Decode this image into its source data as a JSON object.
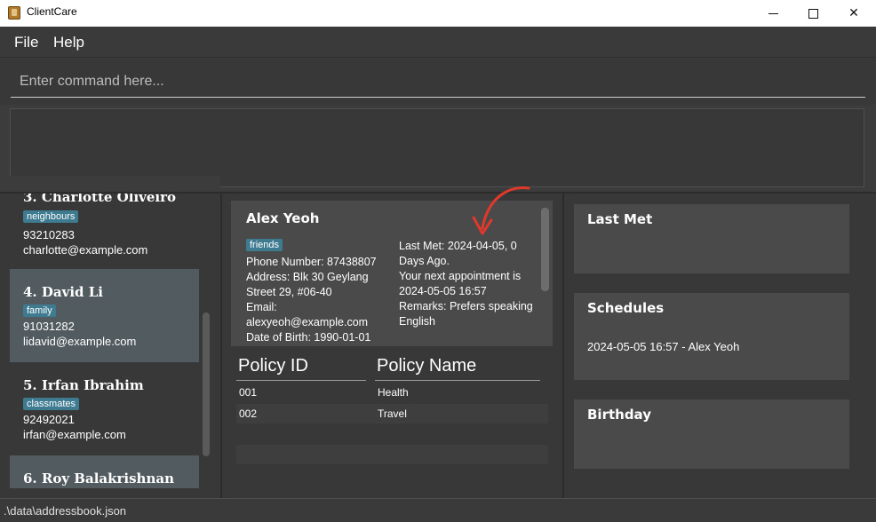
{
  "window": {
    "title": "ClientCare",
    "min_icon": "minimize-icon",
    "max_icon": "maximize-icon",
    "close_symbol": "✕"
  },
  "menu": {
    "items": [
      {
        "label": "File"
      },
      {
        "label": "Help"
      }
    ]
  },
  "command": {
    "placeholder": "Enter command here...",
    "value": ""
  },
  "result": {
    "text": ""
  },
  "person_list": [
    {
      "index_name": "3.  Charlotte Oliveiro",
      "tag": "neighbours",
      "phone": "93210283",
      "email": "charlotte@example.com"
    },
    {
      "index_name": "4.  David Li",
      "tag": "family",
      "phone": "91031282",
      "email": "lidavid@example.com"
    },
    {
      "index_name": "5.  Irfan Ibrahim",
      "tag": "classmates",
      "phone": "92492021",
      "email": "irfan@example.com"
    },
    {
      "index_name": "6.  Roy Balakrishnan",
      "tag": "",
      "phone": "",
      "email": ""
    }
  ],
  "detail": {
    "name": "Alex Yeoh",
    "tag": "friends",
    "left_lines": [
      "Phone Number: 87438807",
      "Address: Blk 30 Geylang",
      "Street 29, #06-40",
      "Email:",
      "alexyeoh@example.com",
      "Date of Birth: 1990-01-01"
    ],
    "right_lines": [
      "Last Met: 2024-04-05, 0",
      "Days Ago.",
      "Your next appointment is",
      "2024-05-05 16:57",
      "Remarks: Prefers speaking",
      "English"
    ]
  },
  "policy_table": {
    "headers": [
      "Policy ID",
      "Policy Name"
    ],
    "rows": [
      {
        "id": "001",
        "name": "Health"
      },
      {
        "id": "002",
        "name": "Travel"
      }
    ]
  },
  "side_panels": {
    "last_met": {
      "title": "Last Met"
    },
    "schedules": {
      "title": "Schedules",
      "entries": [
        "2024-05-05 16:57 - Alex Yeoh"
      ]
    },
    "birthday": {
      "title": "Birthday"
    }
  },
  "status": {
    "path": ".\\data\\addressbook.json"
  },
  "colors": {
    "background": "#3c3c3c",
    "tag": "#3e7b91",
    "selected_card": "#525b5f",
    "annotation": "#e0392b"
  }
}
